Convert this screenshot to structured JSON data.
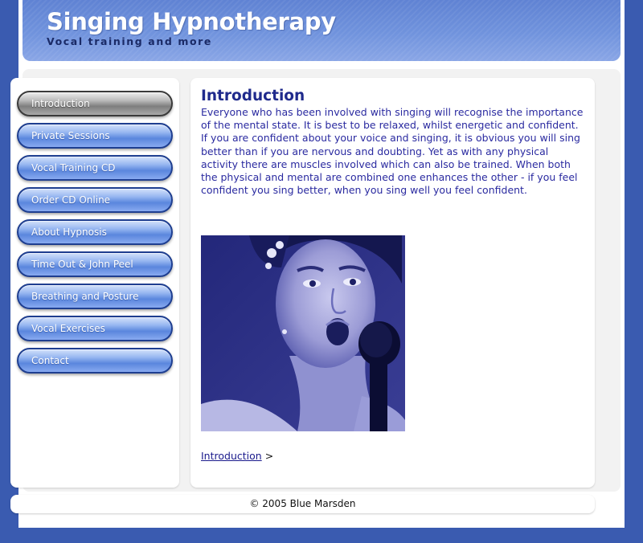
{
  "header": {
    "title": "Singing Hypnotherapy",
    "tagline": "Vocal training and more"
  },
  "nav": {
    "items": [
      {
        "label": "Introduction",
        "active": true
      },
      {
        "label": "Private Sessions",
        "active": false
      },
      {
        "label": "Vocal Training CD",
        "active": false
      },
      {
        "label": "Order CD Online",
        "active": false
      },
      {
        "label": "About Hypnosis",
        "active": false
      },
      {
        "label": "Time Out & John Peel",
        "active": false
      },
      {
        "label": "Breathing and Posture",
        "active": false
      },
      {
        "label": "Vocal Exercises",
        "active": false
      },
      {
        "label": "Contact",
        "active": false
      }
    ]
  },
  "content": {
    "title": "Introduction",
    "paragraph_1": "Everyone who has been involved with singing will recognise the importance of the mental state. It is best to be relaxed, whilst energetic and confident.",
    "paragraph_2": "If you are confident about your voice and singing, it is obvious you will sing better than if you are nervous and doubting. Yet as with any physical activity there are muscles involved which can also be trained. When both the physical and mental are combined one enhances the other - if you feel confident you sing better, when you sing well you feel confident.",
    "breadcrumb_link": "Introduction",
    "breadcrumb_separator": ">"
  },
  "footer": {
    "copyright": "© 2005 Blue Marsden"
  },
  "colors": {
    "page_background": "#3a5bb0",
    "heading_text": "#1f2a8c",
    "body_text": "#2a2aa0",
    "button_border": "#1e3e90"
  }
}
